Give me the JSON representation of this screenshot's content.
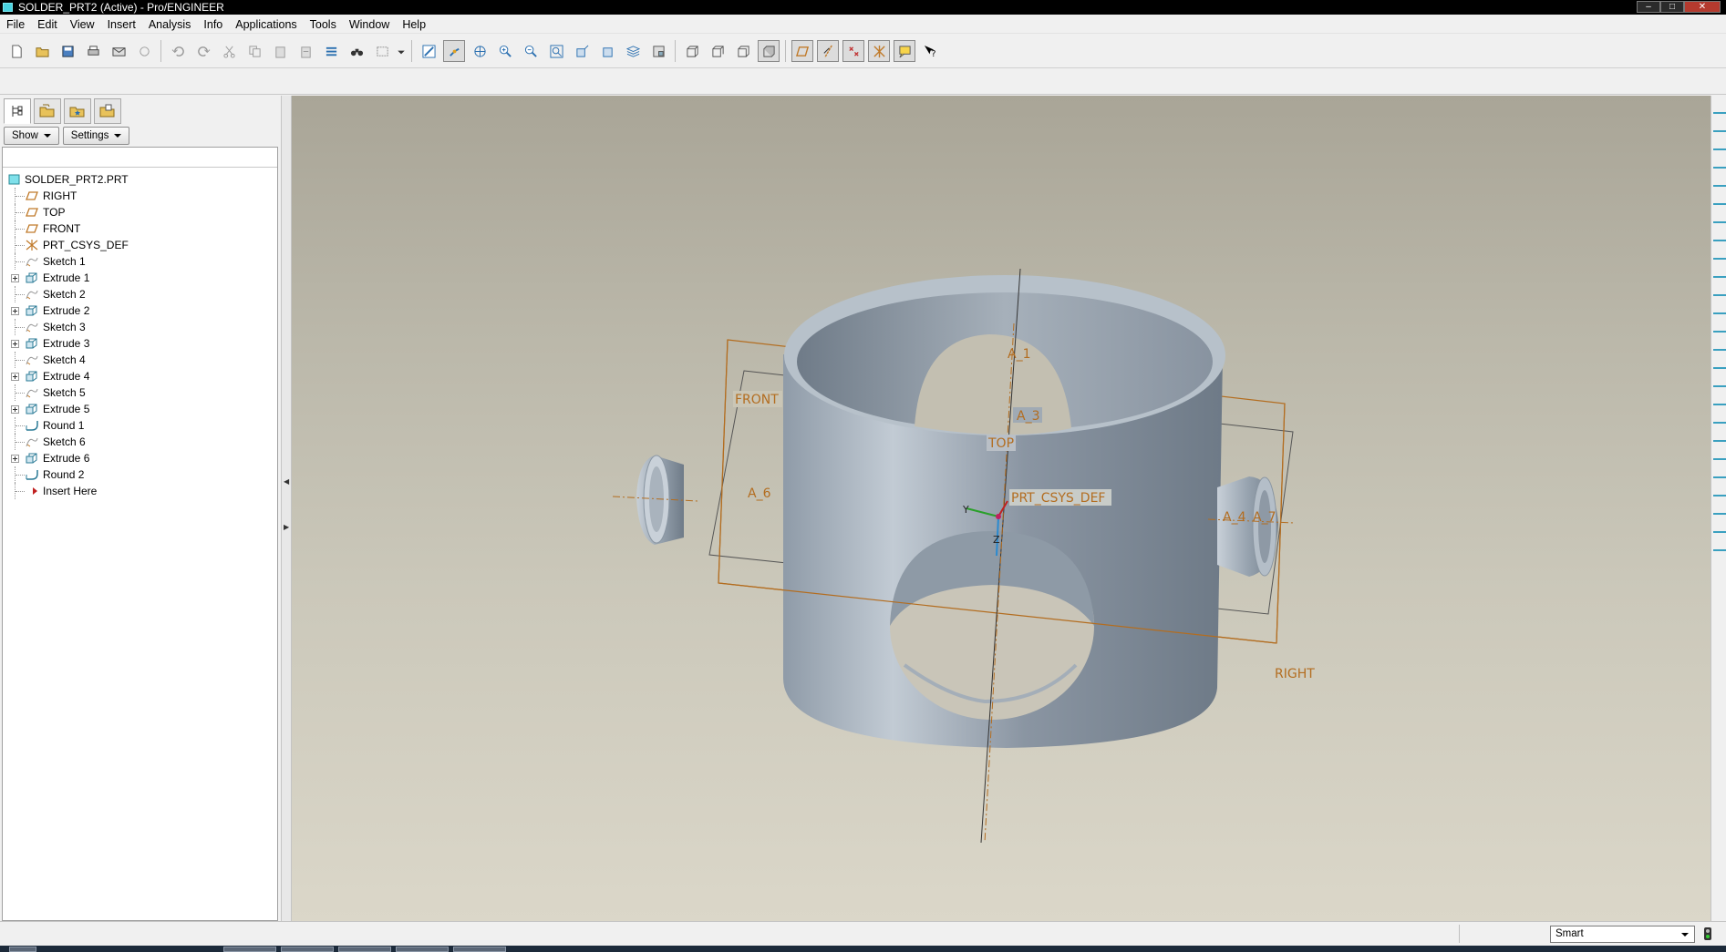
{
  "window": {
    "title": "SOLDER_PRT2 (Active) - Pro/ENGINEER"
  },
  "menu": [
    "File",
    "Edit",
    "View",
    "Insert",
    "Analysis",
    "Info",
    "Applications",
    "Tools",
    "Window",
    "Help"
  ],
  "panel": {
    "show_label": "Show",
    "settings_label": "Settings"
  },
  "tree": {
    "root": "SOLDER_PRT2.PRT",
    "items": [
      {
        "label": "RIGHT",
        "icon": "datum-plane-icon",
        "expandable": false
      },
      {
        "label": "TOP",
        "icon": "datum-plane-icon",
        "expandable": false
      },
      {
        "label": "FRONT",
        "icon": "datum-plane-icon",
        "expandable": false
      },
      {
        "label": "PRT_CSYS_DEF",
        "icon": "csys-icon",
        "expandable": false
      },
      {
        "label": "Sketch 1",
        "icon": "sketch-icon",
        "expandable": false
      },
      {
        "label": "Extrude 1",
        "icon": "extrude-icon",
        "expandable": true
      },
      {
        "label": "Sketch 2",
        "icon": "sketch-icon",
        "expandable": false
      },
      {
        "label": "Extrude 2",
        "icon": "extrude-icon",
        "expandable": true
      },
      {
        "label": "Sketch 3",
        "icon": "sketch-icon",
        "expandable": false
      },
      {
        "label": "Extrude 3",
        "icon": "extrude-icon",
        "expandable": true
      },
      {
        "label": "Sketch 4",
        "icon": "sketch-icon",
        "expandable": false
      },
      {
        "label": "Extrude 4",
        "icon": "extrude-icon",
        "expandable": true
      },
      {
        "label": "Sketch 5",
        "icon": "sketch-icon",
        "expandable": false
      },
      {
        "label": "Extrude 5",
        "icon": "extrude-icon",
        "expandable": true
      },
      {
        "label": "Round 1",
        "icon": "round-icon",
        "expandable": false
      },
      {
        "label": "Sketch 6",
        "icon": "sketch-icon",
        "expandable": false
      },
      {
        "label": "Extrude 6",
        "icon": "extrude-icon",
        "expandable": true
      },
      {
        "label": "Round 2",
        "icon": "round-icon",
        "expandable": false
      },
      {
        "label": "Insert Here",
        "icon": "insert-arrow-icon",
        "expandable": false
      }
    ]
  },
  "model_labels": {
    "front": "FRONT",
    "top": "TOP",
    "right": "RIGHT",
    "csys": "PRT_CSYS_DEF",
    "axis_a1": "A_1",
    "axis_a3": "A_3",
    "axis_a6": "A_6",
    "axis_a4": "A_4",
    "axis_a7": "A_7",
    "y": "Y",
    "z": "Z"
  },
  "status": {
    "filter_value": "Smart"
  },
  "colors": {
    "datum_plane": "#c07a2a",
    "model_body": "#8e9aa6",
    "background_top": "#a9a597",
    "background_bottom": "#dbd7c9"
  }
}
